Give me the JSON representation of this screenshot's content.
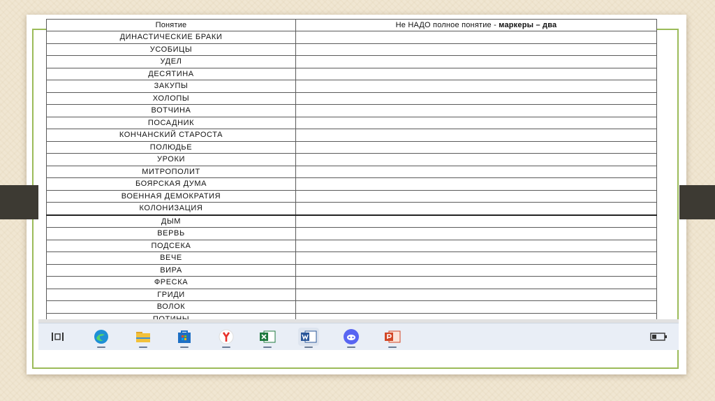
{
  "table": {
    "header": {
      "col1": "Понятие",
      "col2_prefix": "Не НАДО  полное понятие  - ",
      "col2_bold": "маркеры – два"
    },
    "rows": [
      "ДИНАСТИЧЕСКИЕ БРАКИ",
      "УСОБИЦЫ",
      "УДЕЛ",
      "ДЕСЯТИНА",
      "ЗАКУПЫ",
      "ХОЛОПЫ",
      "ВОТЧИНА",
      "ПОСАДНИК",
      "КОНЧАНСКИЙ  СТАРОСТА",
      "ПОЛЮДЬЕ",
      "УРОКИ",
      "МИТРОПОЛИТ",
      "БОЯРСКАЯ  ДУМА",
      "ВОЕННАЯ  ДЕМОКРАТИЯ",
      "КОЛОНИЗАЦИЯ",
      "ДЫМ",
      "ВЕРВЬ",
      "ПОДСЕКА",
      "ВЕЧЕ",
      "ВИРА",
      "ФРЕСКА",
      "ГРИДИ",
      "ВОЛОК",
      "ПОТИНЫ"
    ]
  },
  "taskbar": {
    "icons": [
      {
        "name": "task-view-icon"
      },
      {
        "name": "edge-icon",
        "color": "#1e8fd6"
      },
      {
        "name": "file-explorer-icon",
        "color": "#f3c13a"
      },
      {
        "name": "store-icon",
        "color": "#1d6fc4"
      },
      {
        "name": "yandex-browser-icon",
        "color": "#e8312a"
      },
      {
        "name": "excel-icon",
        "color": "#1f7a3f"
      },
      {
        "name": "word-icon",
        "color": "#2b579a"
      },
      {
        "name": "discord-icon",
        "color": "#5865f2"
      },
      {
        "name": "powerpoint-icon",
        "color": "#d24726"
      },
      {
        "name": "battery-icon"
      }
    ]
  }
}
